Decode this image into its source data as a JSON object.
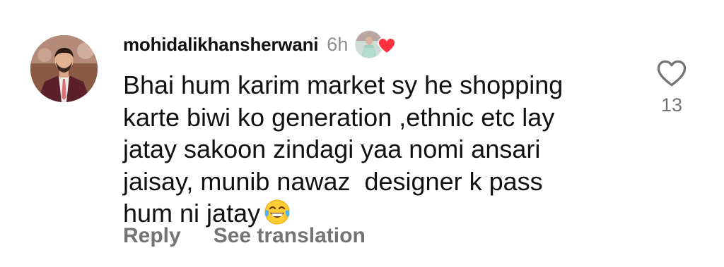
{
  "comment": {
    "username": "mohidalikhansherwani",
    "time_ago": "6h",
    "text": "Bhai hum karim market sy he shopping\nkarte biwi ko generation ,ethnic etc lay\njatay sakoon zindagi yaa nomi ansari\njaisay, munib nawaz  designer k pass\nhum ni jatay",
    "trailing_emoji": "face-with-tears-of-joy",
    "like_count": "13",
    "actions": {
      "reply_label": "Reply",
      "translate_label": "See translation"
    },
    "icons": {
      "like": "heart-outline-icon",
      "author_liked": "heart-filled-icon"
    }
  },
  "colors": {
    "heart_red": "#ff3040",
    "meta_gray": "#8e8e8e",
    "action_gray": "#737373"
  }
}
